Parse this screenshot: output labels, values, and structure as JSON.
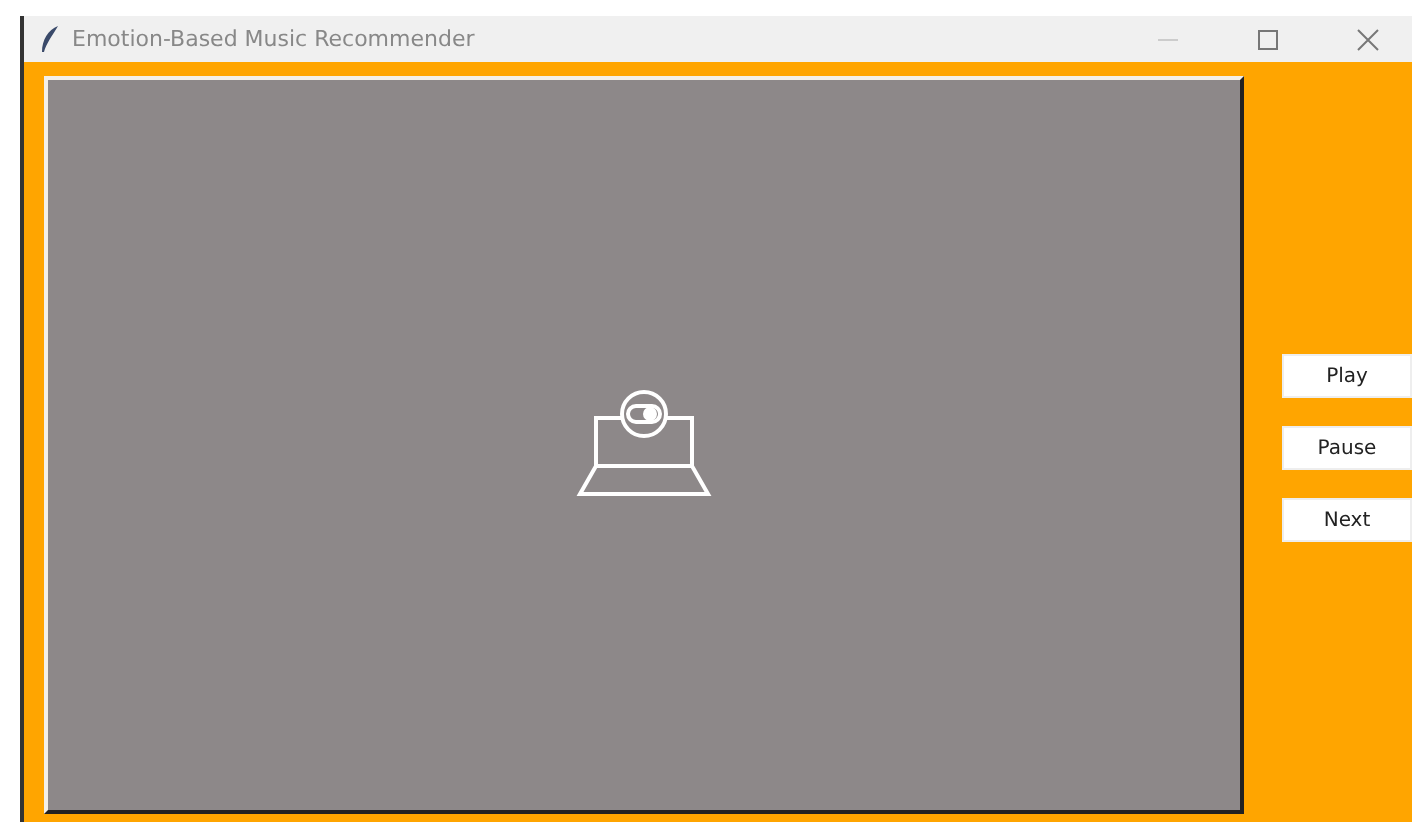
{
  "window": {
    "title": "Emotion-Based Music Recommender"
  },
  "buttons": [
    "Play",
    "Pause",
    "Next"
  ]
}
